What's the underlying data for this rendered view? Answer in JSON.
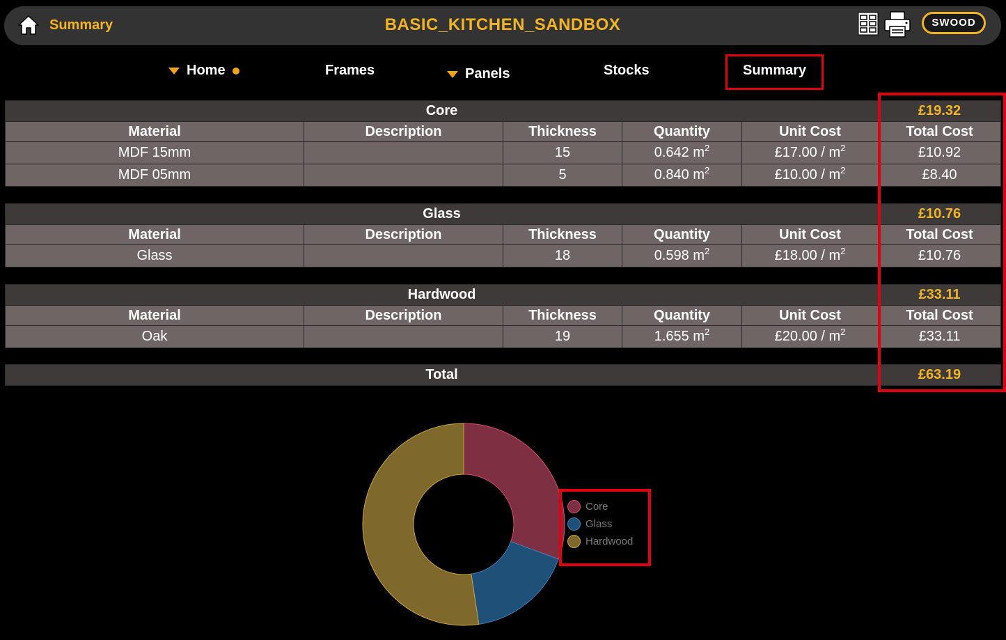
{
  "header": {
    "left_label": "Summary",
    "title": "BASIC_KITCHEN_SANDBOX",
    "brand": "SWOOD",
    "icons": [
      "home-icon",
      "grid-icon",
      "print-icon"
    ]
  },
  "nav": {
    "home": "Home",
    "frames": "Frames",
    "panels": "Panels",
    "stocks": "Stocks",
    "summary": "Summary"
  },
  "columns": {
    "material": "Material",
    "description": "Description",
    "thickness": "Thickness",
    "quantity": "Quantity",
    "unit_cost": "Unit Cost",
    "total_cost": "Total Cost"
  },
  "sections": [
    {
      "name": "Core",
      "total": "£19.32",
      "rows": [
        {
          "material": "MDF 15mm",
          "description": "",
          "thickness": "15",
          "quantity": "0.642 m",
          "quantity_exp": "2",
          "unit_cost": "£17.00 / m",
          "unit_exp": "2",
          "total_cost": "£10.92"
        },
        {
          "material": "MDF 05mm",
          "description": "",
          "thickness": "5",
          "quantity": "0.840 m",
          "quantity_exp": "2",
          "unit_cost": "£10.00 / m",
          "unit_exp": "2",
          "total_cost": "£8.40"
        }
      ]
    },
    {
      "name": "Glass",
      "total": "£10.76",
      "rows": [
        {
          "material": "Glass",
          "description": "",
          "thickness": "18",
          "quantity": "0.598 m",
          "quantity_exp": "2",
          "unit_cost": "£18.00 / m",
          "unit_exp": "2",
          "total_cost": "£10.76"
        }
      ]
    },
    {
      "name": "Hardwood",
      "total": "£33.11",
      "rows": [
        {
          "material": "Oak",
          "description": "",
          "thickness": "19",
          "quantity": "1.655 m",
          "quantity_exp": "2",
          "unit_cost": "£20.00 / m",
          "unit_exp": "2",
          "total_cost": "£33.11"
        }
      ]
    }
  ],
  "grand_total": {
    "label": "Total",
    "value": "£63.19"
  },
  "colors": {
    "accent": "#f2b420",
    "highlight": "#e3000f",
    "core": "#7f2f42",
    "glass": "#1f5078",
    "hardwood": "#7f682c"
  },
  "chart_data": {
    "type": "pie",
    "donut": true,
    "categories": [
      "Core",
      "Glass",
      "Hardwood"
    ],
    "values": [
      19.32,
      10.76,
      33.11
    ],
    "colors": [
      "#7f2f42",
      "#1f5078",
      "#7f682c"
    ],
    "border_colors": [
      "#d64a6a",
      "#3d7fb8",
      "#c9a640"
    ],
    "legend": "right"
  }
}
